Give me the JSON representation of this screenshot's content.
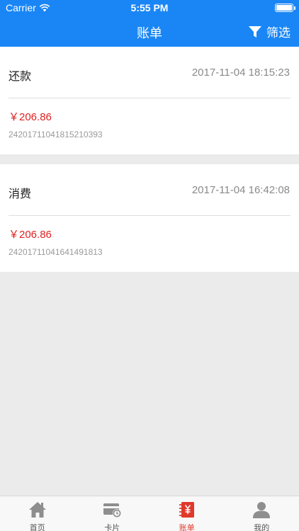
{
  "status_bar": {
    "carrier": "Carrier",
    "time": "5:55 PM"
  },
  "nav": {
    "title": "账单",
    "filter_label": "筛选"
  },
  "records": [
    {
      "type": "还款",
      "datetime": "2017-11-04 18:15:23",
      "amount": "￥206.86",
      "order_no": "24201711041815210393"
    },
    {
      "type": "消费",
      "datetime": "2017-11-04 16:42:08",
      "amount": "￥206.86",
      "order_no": "24201711041641491813"
    }
  ],
  "tabs": [
    {
      "label": "首页",
      "icon": "home-icon"
    },
    {
      "label": "卡片",
      "icon": "card-icon"
    },
    {
      "label": "账单",
      "icon": "bill-icon",
      "active": true
    },
    {
      "label": "我的",
      "icon": "user-icon"
    }
  ],
  "colors": {
    "header": "#1a86f5",
    "amount": "#e02020",
    "active_tab": "#e0392b",
    "inactive_tab": "#8e8e8e"
  }
}
